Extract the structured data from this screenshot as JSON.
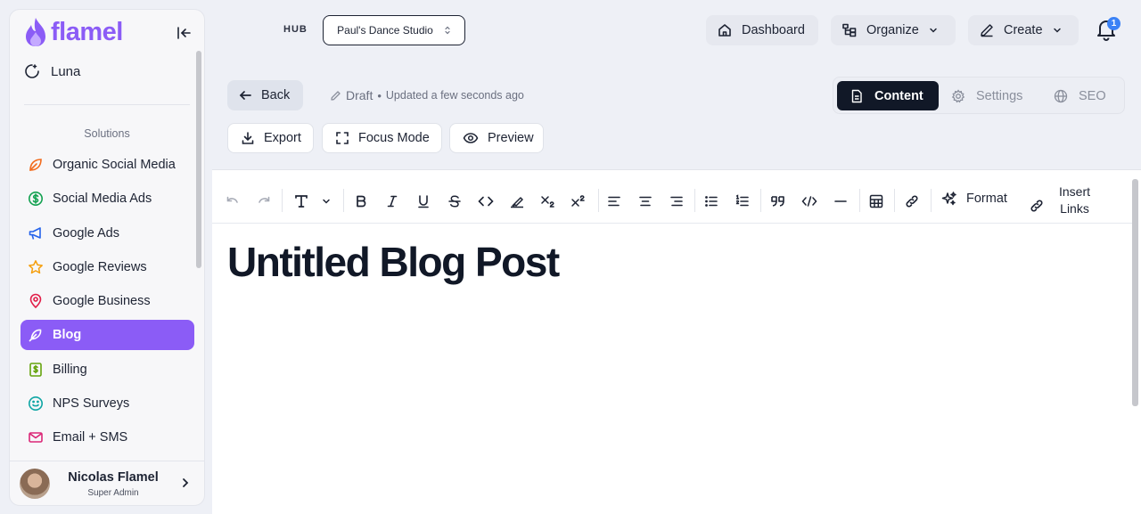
{
  "sidebar": {
    "logo": "flamel",
    "luna": "Luna",
    "section": "Solutions",
    "items": [
      {
        "label": "Organic Social Media",
        "active": false
      },
      {
        "label": "Social Media Ads",
        "active": false
      },
      {
        "label": "Google Ads",
        "active": false
      },
      {
        "label": "Google Reviews",
        "active": false
      },
      {
        "label": "Google Business",
        "active": false
      },
      {
        "label": "Blog",
        "active": true
      },
      {
        "label": "Billing",
        "active": false
      },
      {
        "label": "NPS Surveys",
        "active": false
      },
      {
        "label": "Email + SMS",
        "active": false
      }
    ],
    "user": {
      "name": "Nicolas Flamel",
      "role": "Super Admin"
    }
  },
  "topbar": {
    "hub_label": "HUB",
    "hub_value": "Paul's Dance Studio",
    "dashboard": "Dashboard",
    "organize": "Organize",
    "create": "Create",
    "notifications": "1"
  },
  "header": {
    "back": "Back",
    "draft": "Draft",
    "separator": "•",
    "updated": "Updated a few seconds ago",
    "tabs": [
      "Content",
      "Settings",
      "SEO"
    ],
    "export": "Export",
    "focus_mode": "Focus Mode",
    "preview": "Preview"
  },
  "toolbar": {
    "format": "Format",
    "insert_line1": "Insert",
    "insert_line2": "Links"
  },
  "editor": {
    "title": "Untitled Blog Post"
  },
  "colors": {
    "accent": "#8b5cf6",
    "dark": "#111827",
    "badge": "#3b82f6"
  }
}
